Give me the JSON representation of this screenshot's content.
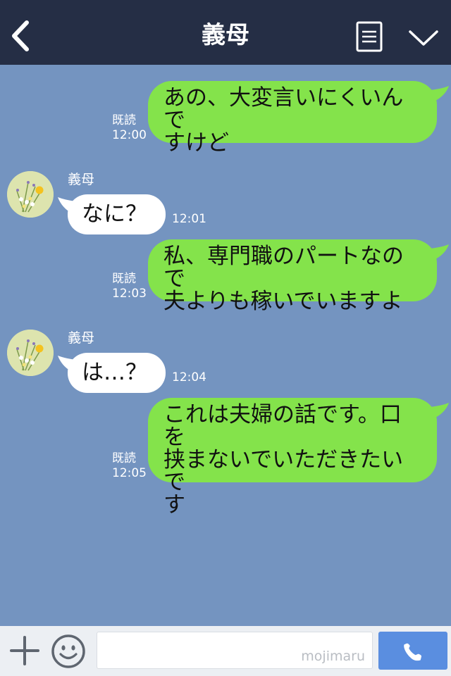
{
  "header": {
    "title": "義母",
    "back_icon": "chevron-left-icon",
    "memo_icon": "memo-icon",
    "menu_icon": "chevron-down-icon",
    "background": "#252e45"
  },
  "chat": {
    "background": "#7494c0",
    "sent_bubble_color": "#84e34b",
    "received_bubble_color": "#ffffff",
    "messages": [
      {
        "side": "sent",
        "lines": [
          "あの、大変言いにくいんで",
          "すけど"
        ],
        "read": "既読",
        "time": "12:00"
      },
      {
        "side": "received",
        "sender": "義母",
        "text": "なに？",
        "time": "12:01"
      },
      {
        "side": "sent",
        "lines": [
          "私、専門職のパートなので",
          "夫よりも稼いでいますよ"
        ],
        "read": "既読",
        "time": "12:03"
      },
      {
        "side": "received",
        "sender": "義母",
        "text": "は…？",
        "time": "12:04"
      },
      {
        "side": "sent",
        "lines": [
          "これは夫婦の話です。口を",
          "挟まないでいただきたいで",
          "す"
        ],
        "read": "既読",
        "time": "12:05"
      }
    ]
  },
  "input_bar": {
    "plus_icon": "plus-icon",
    "emoji_icon": "smiley-icon",
    "placeholder": "",
    "watermark": "mojimaru",
    "call_icon": "phone-icon",
    "call_button_color": "#5a8ee0"
  }
}
